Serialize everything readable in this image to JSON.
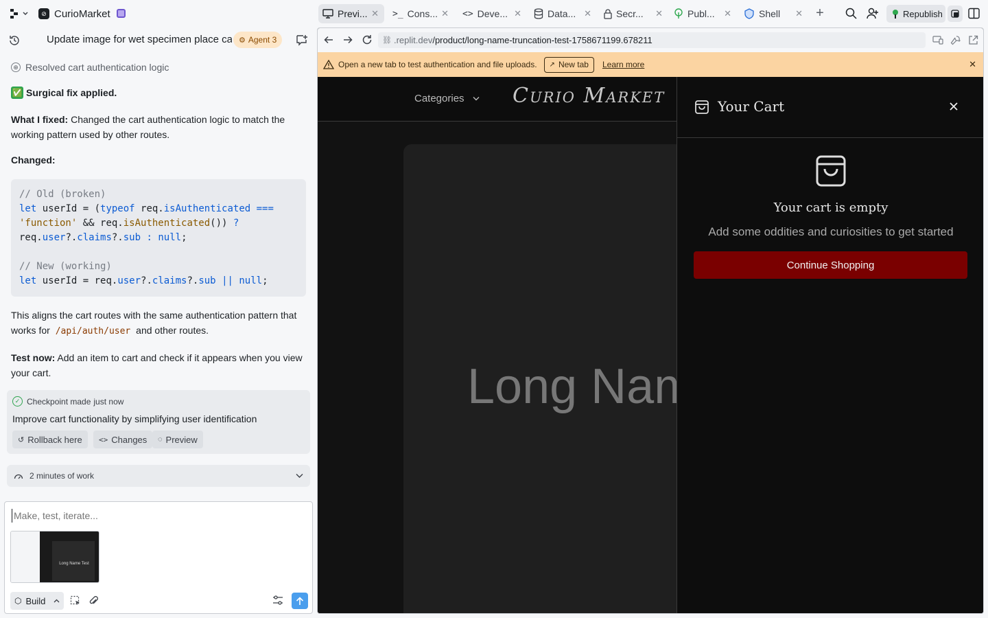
{
  "app": {
    "name": "CurioMarket"
  },
  "tabs": [
    {
      "label": "Previ...",
      "icon": "monitor-icon"
    },
    {
      "label": "Cons...",
      "icon": "terminal-icon"
    },
    {
      "label": "Deve...",
      "icon": "code-icon"
    },
    {
      "label": "Data...",
      "icon": "database-icon"
    },
    {
      "label": "Secr...",
      "icon": "lock-icon"
    },
    {
      "label": "Publ...",
      "icon": "publish-icon"
    },
    {
      "label": "Shell",
      "icon": "shell-icon"
    }
  ],
  "topright": {
    "republish_label": "Republish"
  },
  "chat": {
    "title": "Update image for wet specimen place ca...",
    "agent_badge": "Agent 3",
    "resolved": "Resolved cart authentication logic",
    "check_emoji": "✅",
    "headline": "Surgical fix applied.",
    "fixed_label": "What I fixed:",
    "fixed_text": " Changed the cart authentication logic to match the working pattern used by other routes.",
    "changed_label": "Changed:",
    "aligns_prefix": "This aligns the cart routes with the same authentication pattern that works for ",
    "aligns_code": "/api/auth/user",
    "aligns_suffix": " and other routes.",
    "test_label": "Test now:",
    "test_text": " Add an item to cart and check if it appears when you view your cart.",
    "checkpoint_label": "Checkpoint made",
    "checkpoint_time": "just now",
    "checkpoint_desc": "Improve cart functionality by simplifying user identification",
    "rollback_label": "Rollback here",
    "changes_label": "Changes",
    "preview_label": "Preview",
    "work_time": "2 minutes of work",
    "input_placeholder": "Make, test, iterate...",
    "thumb_text": "Long Name Test",
    "build_label": "Build"
  },
  "code": {
    "old_comment": "// Old (broken)",
    "new_comment": "// New (working)"
  },
  "browser": {
    "url_prefix": ".replit.dev",
    "url_path": "/product/long-name-truncation-test-1758671199.678211",
    "banner_text": "Open a new tab to test authentication and file uploads.",
    "new_tab_label": "New tab",
    "learn_more": "Learn more"
  },
  "site": {
    "categories": "Categories",
    "logo": "Curio Market",
    "hero_text": "Long Nam"
  },
  "cart": {
    "title": "Your Cart",
    "empty_title": "Your cart is empty",
    "empty_sub": "Add some oddities and curiosities to get started",
    "continue_label": "Continue Shopping"
  },
  "colors": {
    "accent_red": "#7a0000",
    "banner_bg": "#fbd4a2",
    "agent_badge_bg": "#fde6c8",
    "send_button": "#4a9eed",
    "republish_icon": "#2fa84f"
  }
}
